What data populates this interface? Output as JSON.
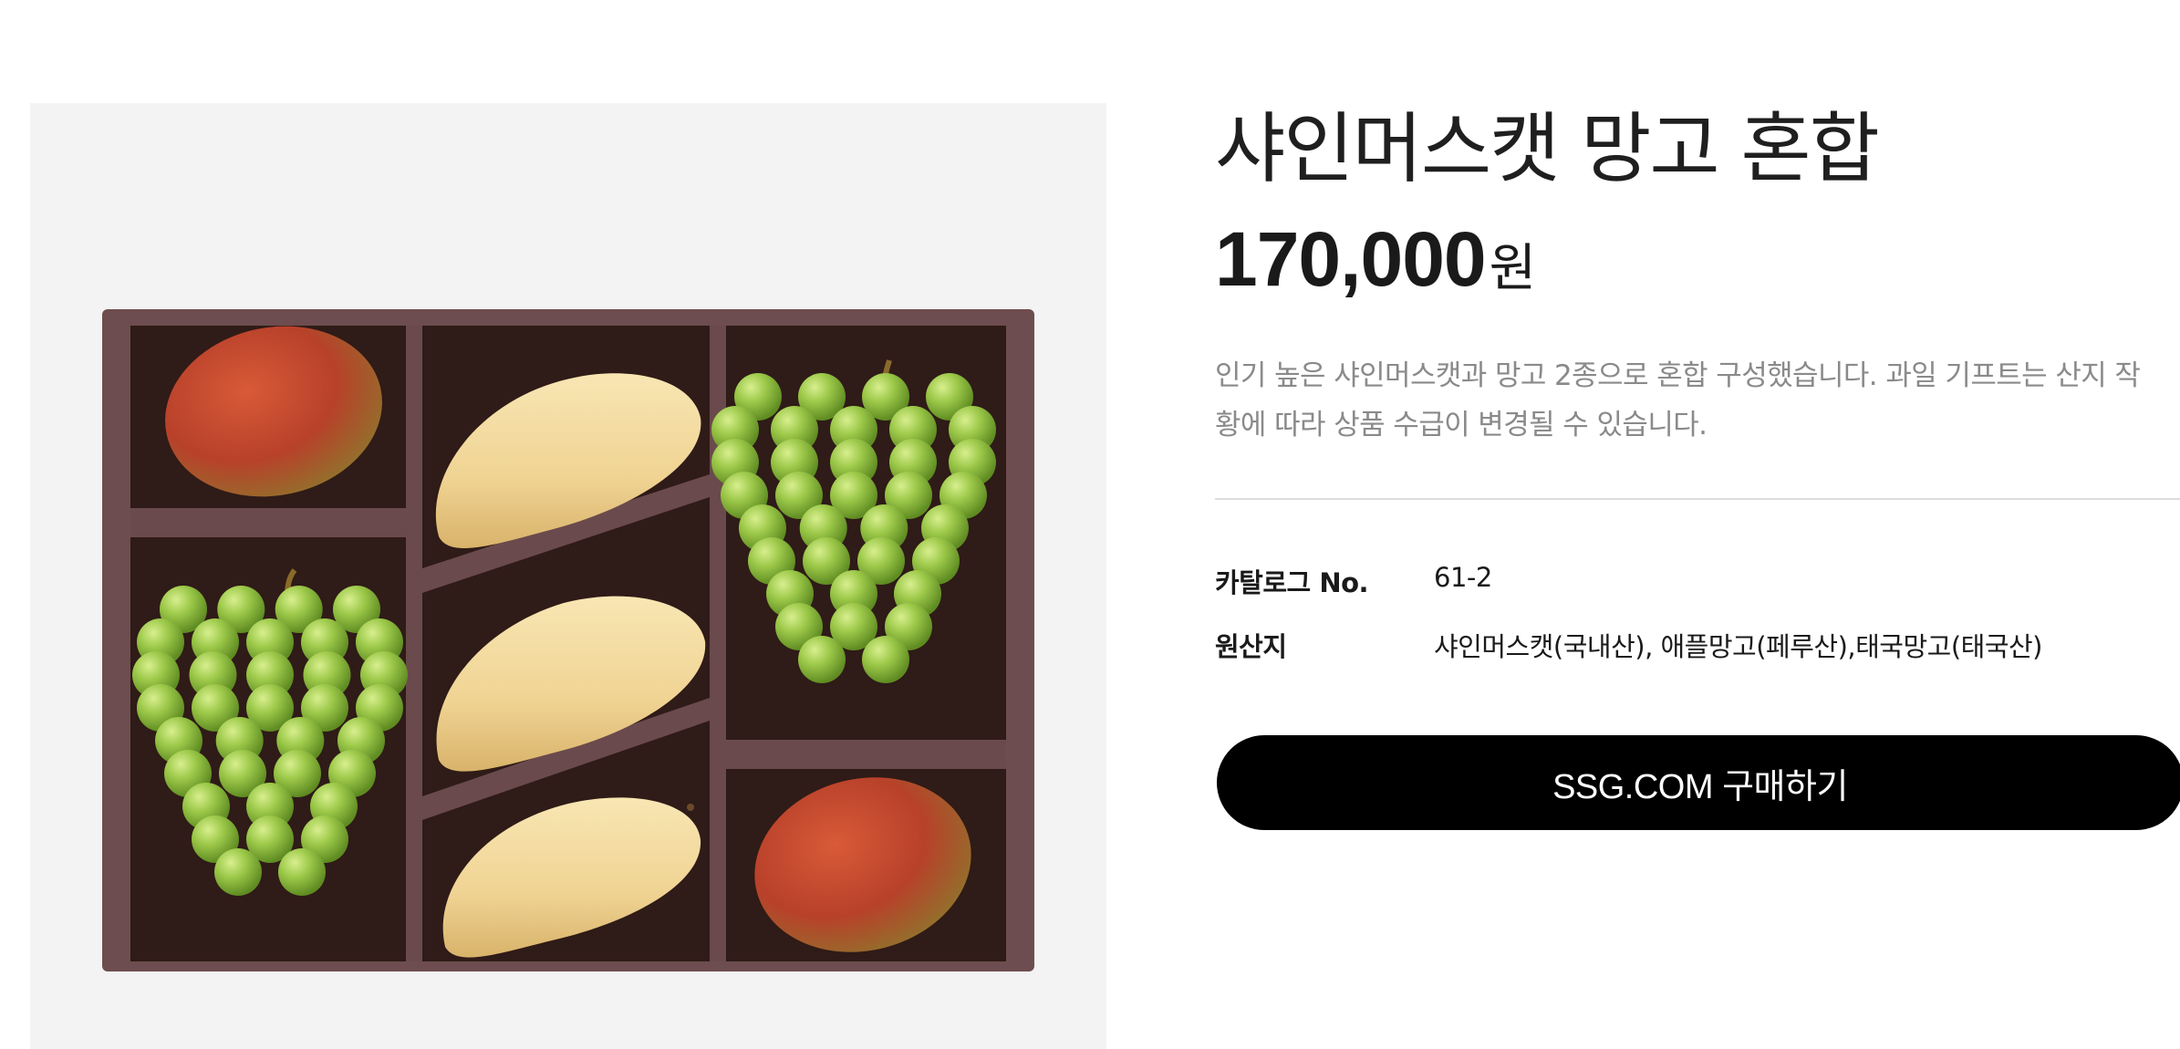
{
  "product": {
    "title": "샤인머스캣 망고 혼합",
    "price_amount": "170,000",
    "price_unit": "원",
    "description": "인기 높은 샤인머스캣과 망고 2종으로 혼합 구성했습니다. 과일 기프트는 산지 작황에 따라 상품 수급이 변경될 수 있습니다."
  },
  "specs": [
    {
      "label": "카탈로그 No.",
      "value": "61-2"
    },
    {
      "label": "원산지",
      "value": "샤인머스캣(국내산), 애플망고(페루산),태국망고(태국산)"
    }
  ],
  "buy_button": {
    "label": "SSG.COM 구매하기"
  },
  "image": {
    "icon": "fruit-gift-box-image",
    "colors": {
      "panel_bg": "#f3f3f3",
      "box_wood": "#6a4a4c",
      "box_inner": "#2e1a16",
      "grape": "#8fbe3f",
      "yellow_mango": "#f1d89a",
      "apple_mango": "#c2472a"
    }
  }
}
